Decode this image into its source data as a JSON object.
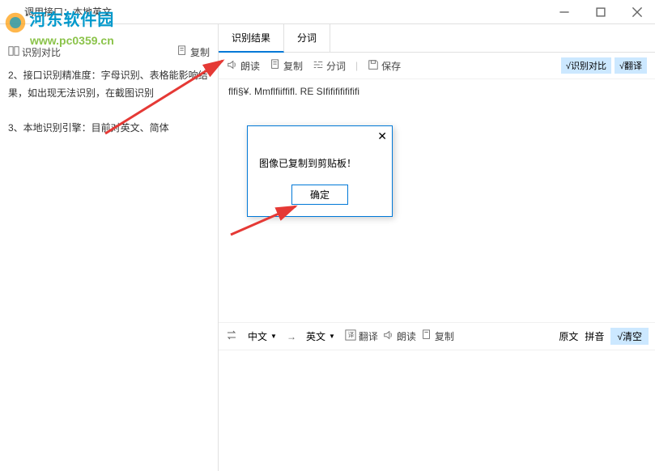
{
  "watermark": {
    "line1": "河东软件园",
    "line2": "www.pc0359.cn"
  },
  "top_info": "调用接口：本地英文",
  "left_toolbar": {
    "compare": "识别对比",
    "copy": "复制"
  },
  "body_text": {
    "line2_partial": "2、接口识别精准度：字母识别、表格能影响结果，如出现无法识别，在截图识别",
    "line3": "3、本地识别引擎：目前对英文、简体"
  },
  "tabs": {
    "result": "识别结果",
    "segment": "分词"
  },
  "right_toolbar": {
    "read": "朗读",
    "copy": "复制",
    "segment": "分词",
    "save": "保存",
    "compare_btn": "√识别对比",
    "translate_btn": "√翻译"
  },
  "result_text": "ﬂﬁ§¥. Mmﬂﬁifﬁﬂ. RE SIﬁﬁﬁﬁﬁﬁﬁ",
  "translate_bar": {
    "src_lang": "中文",
    "dst_lang": "英文",
    "translate": "翻译",
    "read": "朗读",
    "copy": "复制",
    "original": "原文",
    "pinyin": "拼音",
    "clear": "√清空"
  },
  "dialog": {
    "message": "图像已复制到剪贴板！",
    "ok": "确定"
  }
}
